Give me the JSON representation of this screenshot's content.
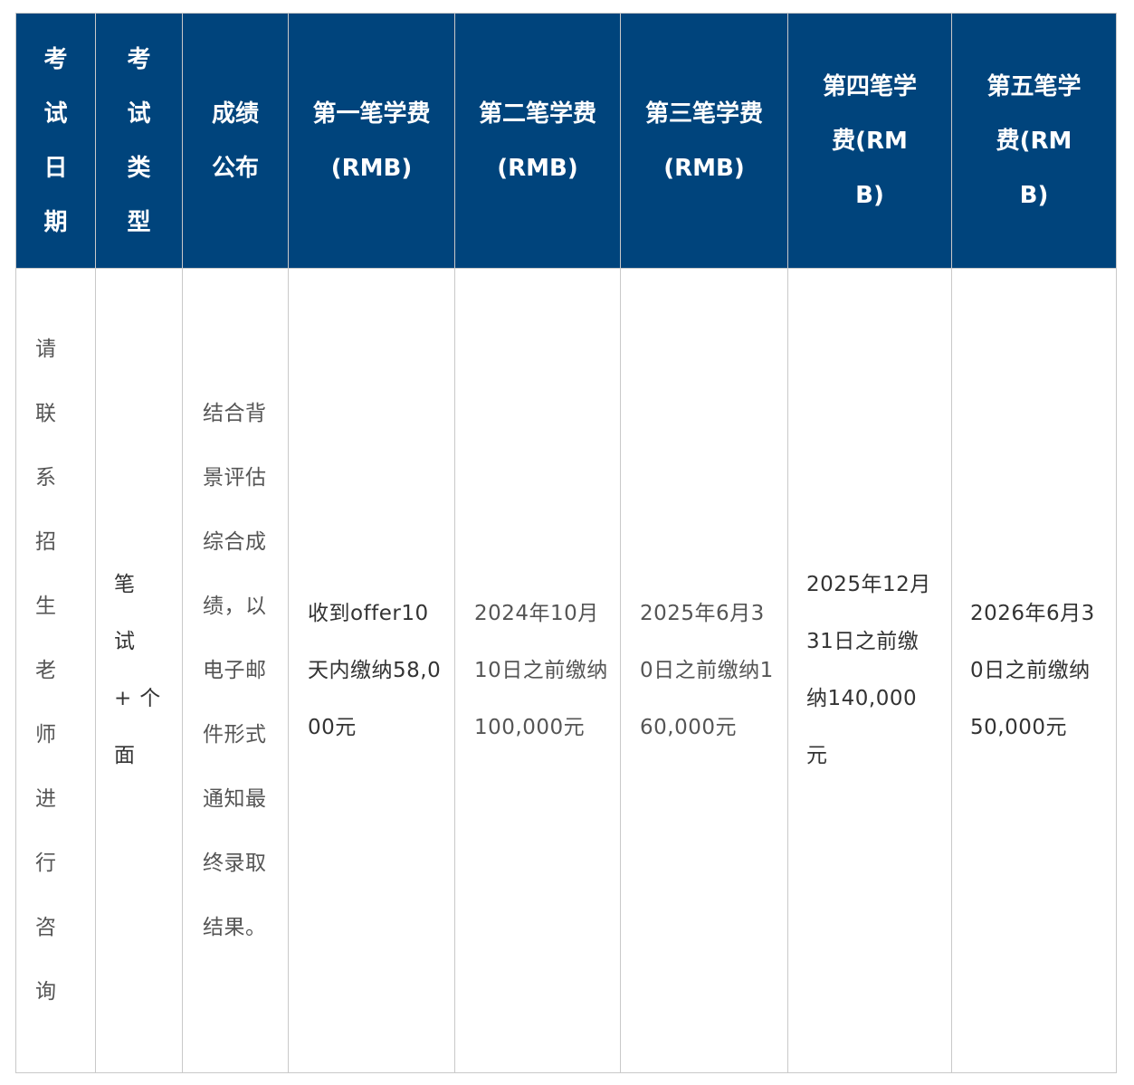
{
  "table": {
    "headers": [
      "考试日期",
      "考试类型",
      "成绩公布",
      "第一笔学费(RMB)",
      "第二笔学费(RMB)",
      "第三笔学费(RMB)",
      "第四笔学费(RMB)",
      "第五笔学费(RMB)"
    ],
    "row": [
      "请联系招生老师进行咨询",
      "笔试+个面",
      "结合背景评估综合成绩，以电子邮件形式通知最终录取结果。",
      "收到offer10天内缴纳58,000元",
      "2024年10月10日之前缴纳100,000元",
      "2025年6月30日之前缴纳160,000元",
      "2025年12月31日之前缴纳140,000元",
      "2026年6月30日之前缴纳50,000元"
    ]
  },
  "colors": {
    "header_bg": "#00447c",
    "header_text": "#ffffff",
    "border": "#c9c9c9",
    "body_text": "#555555"
  }
}
